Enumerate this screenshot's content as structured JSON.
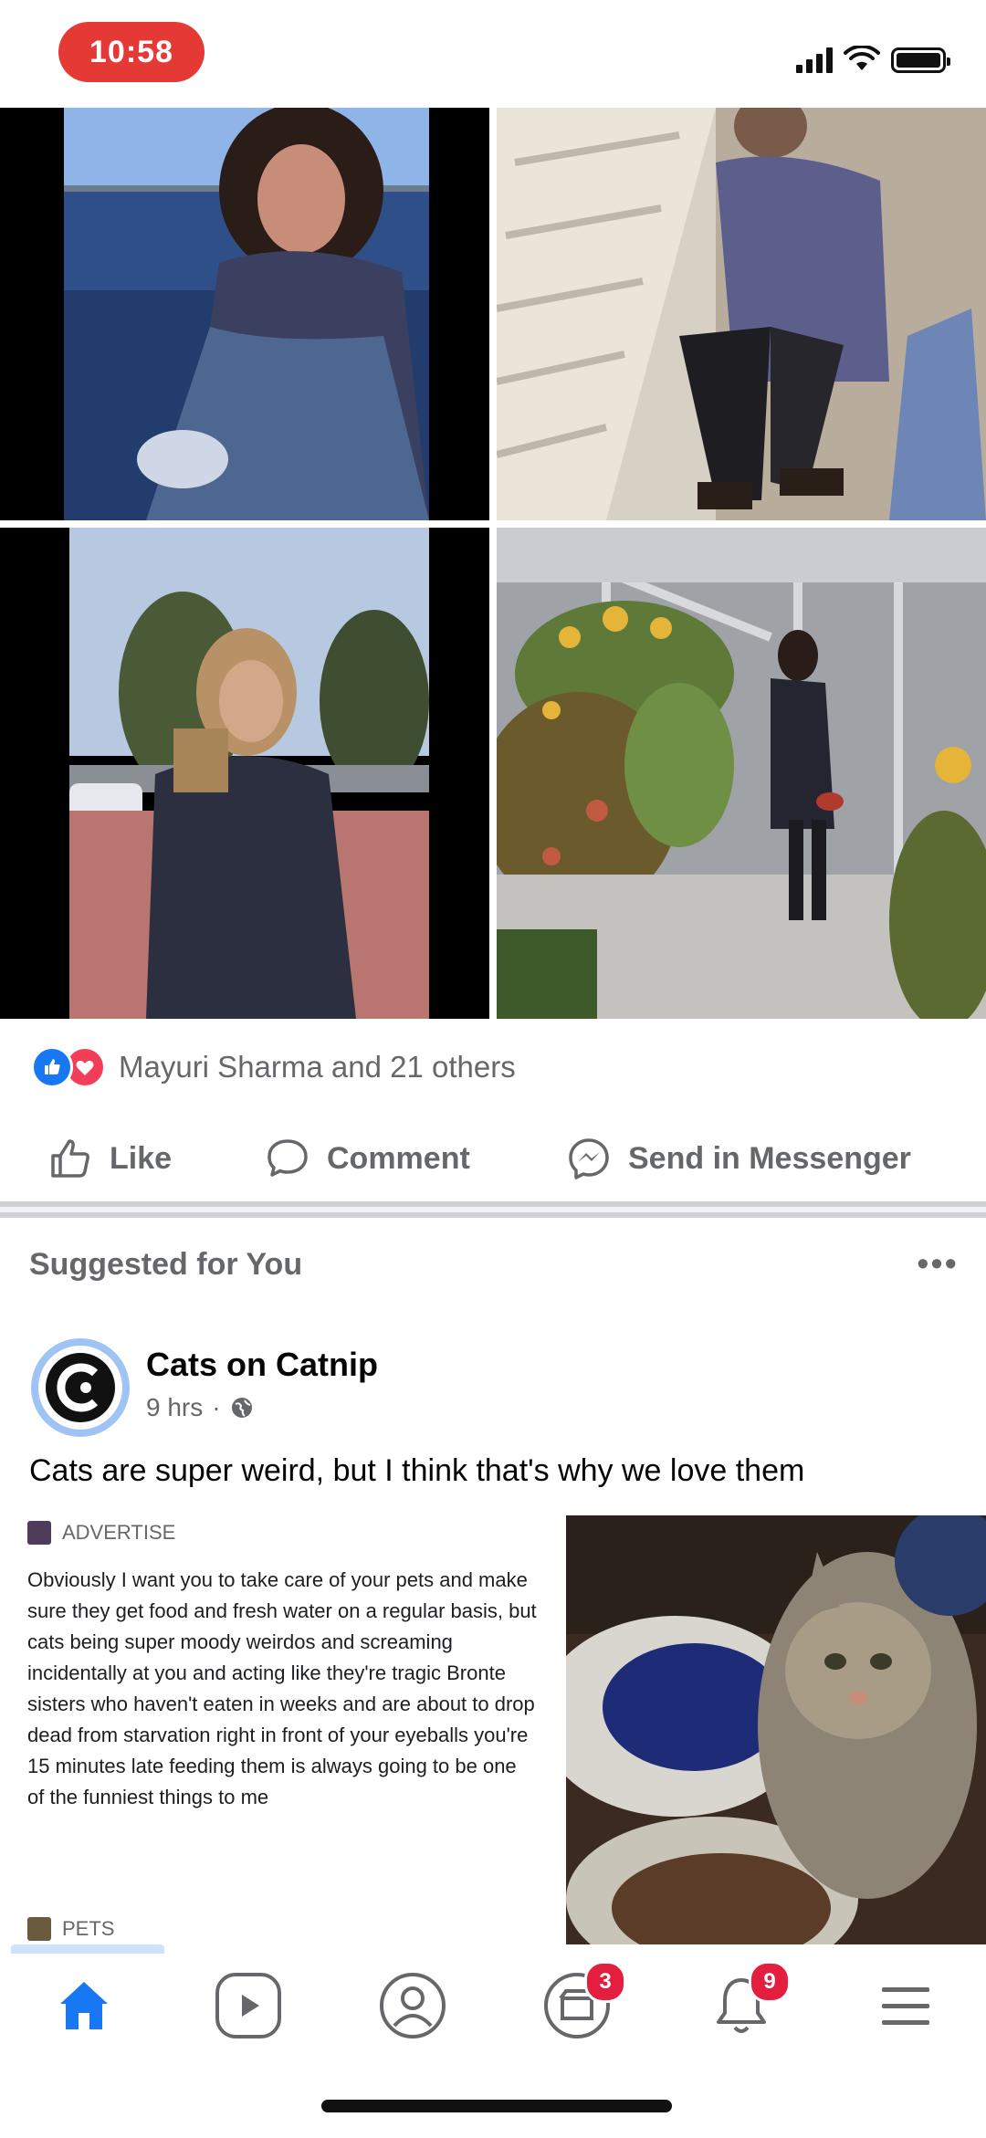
{
  "status_bar": {
    "time": "10:58"
  },
  "photos": [
    {
      "name": "photo-woman-waterfront"
    },
    {
      "name": "photo-person-on-stairs"
    },
    {
      "name": "photo-woman-street"
    },
    {
      "name": "photo-woman-greenhouse"
    }
  ],
  "reactions": {
    "summary": "Mayuri Sharma and 21 others"
  },
  "actions": {
    "like": "Like",
    "comment": "Comment",
    "send": "Send in Messenger"
  },
  "suggested": {
    "header": "Suggested for You",
    "more": "•••",
    "page_name": "Cats on Catnip",
    "time": "9 hrs",
    "dot": "·",
    "post_text": "Cats are super weird, but I think that's why we love them",
    "preview": {
      "source": "ADVERTISE",
      "body": "Obviously I want you to take care of your pets and make sure they get food and fresh water on a regular basis, but cats being super moody weirdos and screaming incidentally at you and acting like they're tragic Bronte sisters who haven't eaten in weeks and are about to drop dead from starvation right in front of your eyeballs you're 15 minutes late feeding them is always going to be one of the funniest things to me",
      "bottom_source": "PETS"
    }
  },
  "tabbar": {
    "notifications_badge": "3",
    "friends_badge": "9"
  },
  "colors": {
    "accent": "#1877f2",
    "badge": "#e41e3f",
    "time_pill": "#e53935"
  }
}
